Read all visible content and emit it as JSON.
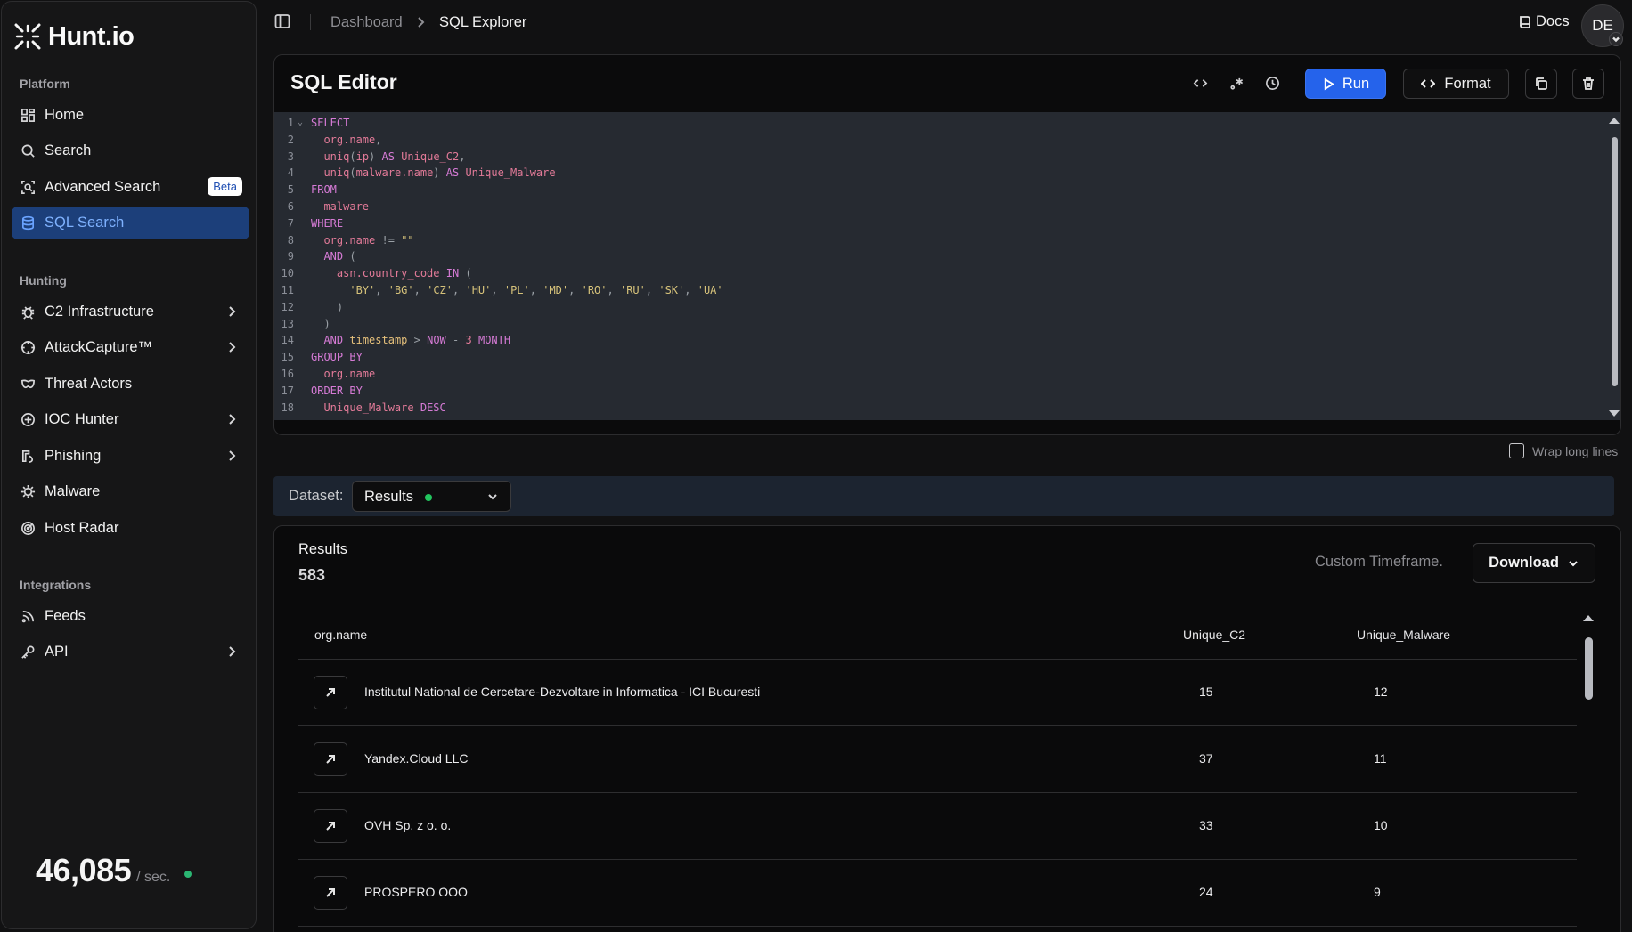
{
  "brand": {
    "name": "Hunt.io"
  },
  "sidebar": {
    "sections": [
      {
        "label": "Platform"
      },
      {
        "label": "Hunting"
      },
      {
        "label": "Integrations"
      }
    ],
    "items": [
      {
        "label": "Home",
        "icon": "home-icon"
      },
      {
        "label": "Search",
        "icon": "search-icon"
      },
      {
        "label": "Advanced Search",
        "icon": "scan-search-icon",
        "badge": "Beta"
      },
      {
        "label": "SQL Search",
        "icon": "database-icon",
        "active": true
      },
      {
        "label": "C2 Infrastructure",
        "icon": "bug-icon",
        "expandable": true
      },
      {
        "label": "AttackCapture™",
        "icon": "crosshair-icon",
        "expandable": true
      },
      {
        "label": "Threat Actors",
        "icon": "mask-icon"
      },
      {
        "label": "IOC Hunter",
        "icon": "plus-circle-icon",
        "expandable": true
      },
      {
        "label": "Phishing",
        "icon": "fish-icon",
        "expandable": true
      },
      {
        "label": "Malware",
        "icon": "virus-icon"
      },
      {
        "label": "Host Radar",
        "icon": "radar-icon"
      },
      {
        "label": "Feeds",
        "icon": "rss-icon"
      },
      {
        "label": "API",
        "icon": "key-icon",
        "expandable": true
      }
    ],
    "counter": {
      "value": "46,085",
      "unit": "/ sec.",
      "status_color": "#2bb673"
    }
  },
  "topbar": {
    "breadcrumb": [
      "Dashboard",
      "SQL Explorer"
    ],
    "docs_label": "Docs",
    "avatar_initials": "DE"
  },
  "editor": {
    "title": "SQL Editor",
    "run_label": "Run",
    "format_label": "Format",
    "wrap_label": "Wrap long lines",
    "lines": [
      "SELECT",
      "  org.name,",
      "  uniq(ip) AS Unique_C2,",
      "  uniq(malware.name) AS Unique_Malware",
      "FROM",
      "  malware",
      "WHERE",
      "  org.name != \"\"",
      "  AND (",
      "    asn.country_code IN (",
      "      'BY', 'BG', 'CZ', 'HU', 'PL', 'MD', 'RO', 'RU', 'SK', 'UA'",
      "    )",
      "  )",
      "  AND timestamp > NOW - 3 MONTH",
      "GROUP BY",
      "  org.name",
      "ORDER BY",
      "  Unique_Malware DESC"
    ]
  },
  "dataset": {
    "label": "Dataset:",
    "selected": "Results",
    "status_color": "#22c55e"
  },
  "results": {
    "label": "Results",
    "count": "583",
    "timeframe_label": "Custom Timeframe.",
    "download_label": "Download",
    "columns": [
      "org.name",
      "Unique_C2",
      "Unique_Malware"
    ],
    "rows": [
      [
        "Institutul National de Cercetare-Dezvoltare in Informatica - ICI Bucuresti",
        "15",
        "12"
      ],
      [
        "Yandex.Cloud LLC",
        "37",
        "11"
      ],
      [
        "OVH Sp. z o. o.",
        "33",
        "10"
      ],
      [
        "PROSPERO OOO",
        "24",
        "9"
      ]
    ]
  }
}
